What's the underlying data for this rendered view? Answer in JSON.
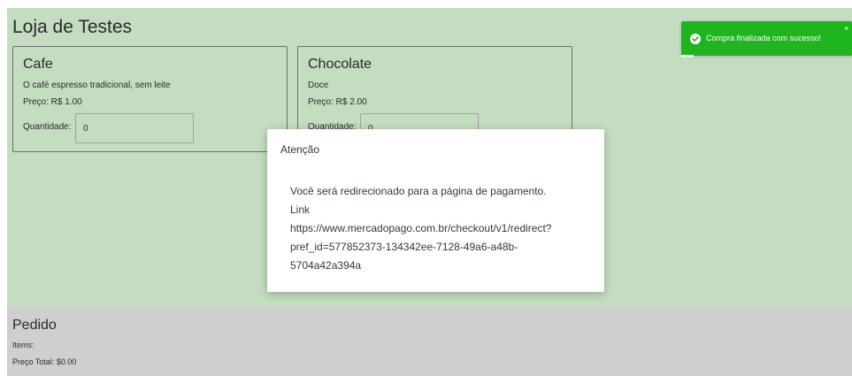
{
  "store": {
    "title": "Loja de Testes"
  },
  "products": [
    {
      "name": "Cafe",
      "description": "O café espresso tradicional, sem leite",
      "price": "Preço: R$ 1.00",
      "quantity_label": "Quantidade:",
      "quantity_value": "0"
    },
    {
      "name": "Chocolate",
      "description": "Doce",
      "price": "Preço: R$ 2.00",
      "quantity_label": "Quantidade:",
      "quantity_value": "0"
    }
  ],
  "order": {
    "title": "Pedido",
    "items_label": "Items:",
    "total_label": "Preço Total: $0.00"
  },
  "dialog": {
    "title": "Atenção",
    "message": "Você será redirecionado para a página de pagamento.",
    "link_label": "Link",
    "link_url": "https://www.mercadopago.com.br/checkout/v1/redirect?pref_id=577852373-134342ee-7128-49a6-a48b-5704a42a394a"
  },
  "toast": {
    "message": "Compra finalizada com sucesso!",
    "close_symbol": "×",
    "icon": "check-circle-icon",
    "color": "#1fb51f"
  },
  "colors": {
    "product_area_bg": "#c4dcc0",
    "order_area_bg": "#cfcfcf"
  }
}
